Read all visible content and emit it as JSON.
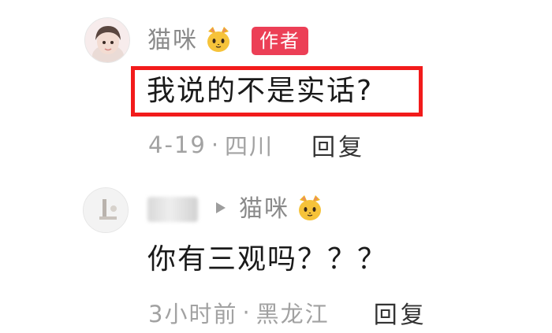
{
  "comments": [
    {
      "username": "猫咪",
      "emoji_icon": "cat-face-icon",
      "badge": "作者",
      "text": "我说的不是实话?",
      "date": "4-19",
      "separator": "·",
      "location": "四川",
      "reply_label": "回复",
      "highlight_color": "#f21b1b"
    },
    {
      "reply_to_username": "猫咪",
      "emoji_icon": "cat-face-icon",
      "text": "你有三观吗？？？",
      "time": "3小时前",
      "separator": "·",
      "location": "黑龙江",
      "reply_label": "回复"
    }
  ],
  "colors": {
    "badge_bg": "#ec3f56",
    "meta_text": "#a2a2a2",
    "username_text": "#8a8a8a",
    "body_text": "#1a1a1a"
  }
}
